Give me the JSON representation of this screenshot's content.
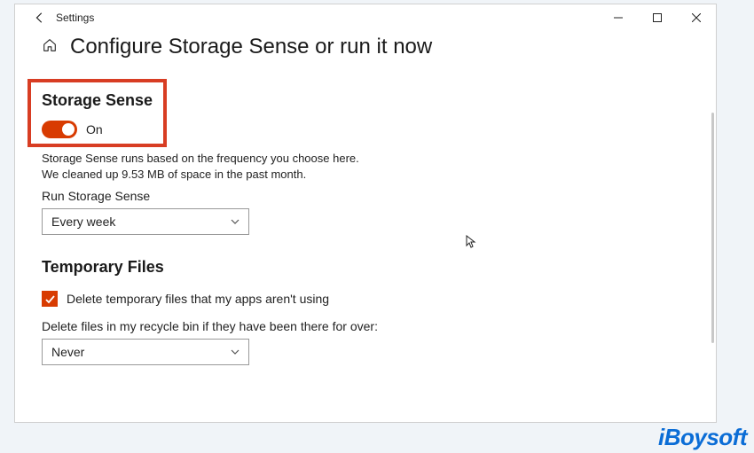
{
  "titlebar": {
    "app": "Settings"
  },
  "header": {
    "title": "Configure Storage Sense or run it now"
  },
  "storage_sense": {
    "heading": "Storage Sense",
    "toggle_state": "On",
    "description": "Storage Sense runs based on the frequency you choose here. We cleaned up 9.53 MB of space in the past month.",
    "run_label": "Run Storage Sense",
    "run_value": "Every week"
  },
  "temp_files": {
    "heading": "Temporary Files",
    "checkbox_label": "Delete temporary files that my apps aren't using",
    "recycle_label": "Delete files in my recycle bin if they have been there for over:",
    "recycle_value": "Never"
  },
  "brand": "iBoysoft"
}
